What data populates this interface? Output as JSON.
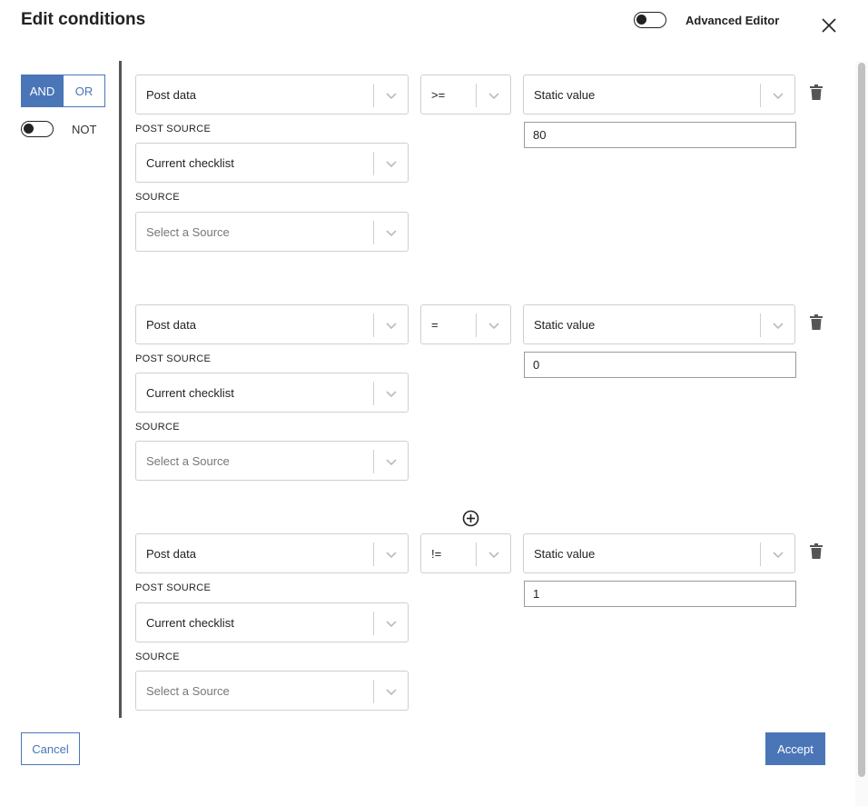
{
  "header": {
    "title": "Edit conditions",
    "advanced_editor_label": "Advanced Editor",
    "advanced_editor_on": false
  },
  "logic": {
    "and_label": "AND",
    "or_label": "OR",
    "selected": "AND",
    "not_label": "NOT",
    "not_on": false
  },
  "conditions": [
    {
      "field": "Post data",
      "operator": ">=",
      "value_type": "Static value",
      "value": "80",
      "post_source_label": "POST SOURCE",
      "post_source": "Current checklist",
      "source_label": "SOURCE",
      "source_placeholder": "Select a Source"
    },
    {
      "field": "Post data",
      "operator": "=",
      "value_type": "Static value",
      "value": "0",
      "post_source_label": "POST SOURCE",
      "post_source": "Current checklist",
      "source_label": "SOURCE",
      "source_placeholder": "Select a Source"
    },
    {
      "field": "Post data",
      "operator": "!=",
      "value_type": "Static value",
      "value": "1",
      "post_source_label": "POST SOURCE",
      "post_source": "Current checklist",
      "source_label": "SOURCE",
      "source_placeholder": "Select a Source"
    }
  ],
  "footer": {
    "cancel_label": "Cancel",
    "accept_label": "Accept"
  },
  "colors": {
    "accent": "#4a76b8",
    "border": "#cfcfcf",
    "text": "#222222"
  },
  "icons": {
    "close": "close-icon",
    "chevron": "chevron-down-icon",
    "trash": "trash-icon",
    "add": "add-circle-icon"
  }
}
